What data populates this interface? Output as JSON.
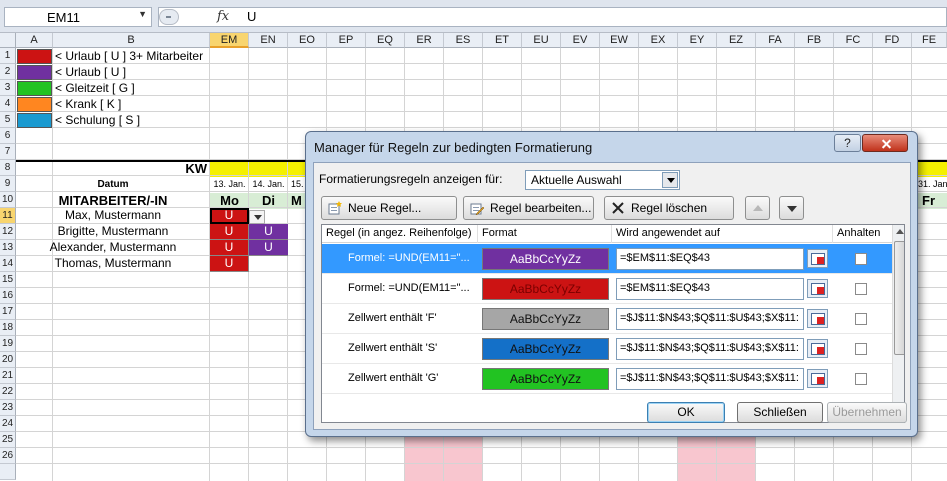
{
  "formula_bar": {
    "name_box": "EM11",
    "fx": "fx",
    "value": "U"
  },
  "columns": [
    "A",
    "B",
    "EM",
    "EN",
    "EO",
    "EP",
    "EQ",
    "ER",
    "ES",
    "ET",
    "EU",
    "EV",
    "EW",
    "EX",
    "EY",
    "EZ",
    "FA",
    "FB",
    "FC",
    "FD",
    "FE"
  ],
  "selected_column": "EM",
  "rows": [
    "1",
    "2",
    "3",
    "4",
    "5",
    "6",
    "7",
    "8",
    "9",
    "10",
    "11",
    "12",
    "13",
    "14",
    "15",
    "16",
    "17",
    "18",
    "19",
    "20",
    "21",
    "22",
    "23",
    "24",
    "25",
    "26"
  ],
  "selected_row": "11",
  "legend": [
    {
      "color": "#cc1313",
      "label": "< Urlaub [ U ] 3+ Mitarbeiter"
    },
    {
      "color": "#7030a0",
      "label": "< Urlaub [ U ]"
    },
    {
      "color": "#22c322",
      "label": "< Gleitzeit [ G ]"
    },
    {
      "color": "#ff8620",
      "label": "< Krank [ K ]"
    },
    {
      "color": "#1a9ad0",
      "label": "< Schulung [ S ]"
    }
  ],
  "sheet": {
    "kw_label": "KW",
    "datum_label": "Datum",
    "header_label": "MITARBEITER/-IN",
    "dates": [
      "13. Jan.",
      "14. Jan.",
      "15."
    ],
    "days": [
      "Mo",
      "Di",
      "M"
    ],
    "right_date": "31. Jan.",
    "right_day": "Fr",
    "employees": [
      "Max, Mustermann",
      "Brigitte, Mustermann",
      "Alexander, Mustermann",
      "Thomas, Mustermann"
    ],
    "cell_code": "U"
  },
  "dialog": {
    "title": "Manager für Regeln zur bedingten Formatierung",
    "help": "?",
    "show_rules_label": "Formatierungsregeln anzeigen für:",
    "show_rules_value": "Aktuelle Auswahl",
    "new_rule": "Neue Regel...",
    "edit_rule": "Regel bearbeiten...",
    "delete_rule": "Regel löschen",
    "col_rule": "Regel (in angez. Reihenfolge)",
    "col_format": "Format",
    "col_applies": "Wird angewendet auf",
    "col_stop": "Anhalten",
    "rules": [
      {
        "rule": "Formel: =UND(EM11=\"...",
        "format_text": "AaBbCcYyZz",
        "format_bg": "#7030a0",
        "format_fg": "#ffffff",
        "applies": "=$EM$11:$EQ$43"
      },
      {
        "rule": "Formel: =UND(EM11=\"...",
        "format_text": "AaBbCcYyZz",
        "format_bg": "#cc1313",
        "format_fg": "#7a0000",
        "applies": "=$EM$11:$EQ$43"
      },
      {
        "rule": "Zellwert enthält 'F'",
        "format_text": "AaBbCcYyZz",
        "format_bg": "#a6a6a6",
        "format_fg": "#111111",
        "applies": "=$J$11:$N$43;$Q$11:$U$43;$X$11:"
      },
      {
        "rule": "Zellwert enthält 'S'",
        "format_text": "AaBbCcYyZz",
        "format_bg": "#1470c8",
        "format_fg": "#111111",
        "applies": "=$J$11:$N$43;$Q$11:$U$43;$X$11:"
      },
      {
        "rule": "Zellwert enthält 'G'",
        "format_text": "AaBbCcYyZz",
        "format_bg": "#22c322",
        "format_fg": "#111111",
        "applies": "=$J$11:$N$43;$Q$11:$U$43;$X$11:"
      }
    ],
    "ok": "OK",
    "close": "Schließen",
    "apply": "Übernehmen"
  }
}
